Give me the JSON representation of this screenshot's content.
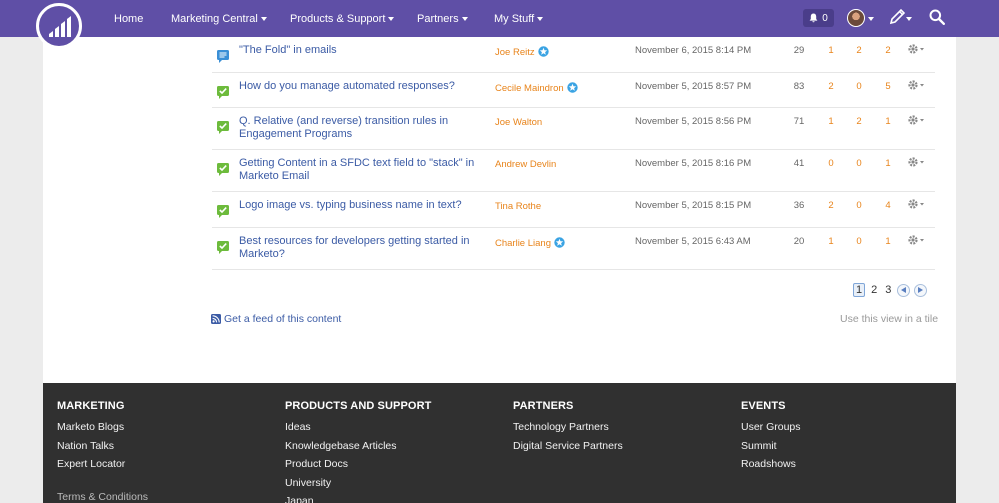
{
  "nav": {
    "items": [
      "Home",
      "Marketing Central",
      "Products & Support",
      "Partners",
      "My Stuff"
    ],
    "notifications": "0",
    "icons": [
      "marketo-logo-icon",
      "bell-icon",
      "avatar",
      "pencil-icon",
      "search-icon"
    ]
  },
  "threads": [
    {
      "icon": "discussion",
      "title": "\"The Fold\" in emails",
      "author": "Joe Reitz",
      "badge": true,
      "date": "November 6, 2015 8:14 PM",
      "views": "29",
      "c1": "1",
      "c2": "2",
      "c3": "2"
    },
    {
      "icon": "answered",
      "title": "How do you manage automated responses?",
      "author": "Cecile Maindron",
      "badge": true,
      "date": "November 5, 2015 8:57 PM",
      "views": "83",
      "c1": "2",
      "c2": "0",
      "c3": "5"
    },
    {
      "icon": "answered",
      "title": "Q. Relative (and reverse) transition rules in Engagement Programs",
      "author": "Joe Walton",
      "badge": false,
      "date": "November 5, 2015 8:56 PM",
      "views": "71",
      "c1": "1",
      "c2": "2",
      "c3": "1"
    },
    {
      "icon": "answered",
      "title": "Getting Content in a SFDC text field to \"stack\" in Marketo Email",
      "author": "Andrew Devlin",
      "badge": false,
      "date": "November 5, 2015 8:16 PM",
      "views": "41",
      "c1": "0",
      "c2": "0",
      "c3": "1"
    },
    {
      "icon": "answered",
      "title": "Logo image vs. typing business name in text?",
      "author": "Tina Rothe",
      "badge": false,
      "date": "November 5, 2015 8:15 PM",
      "views": "36",
      "c1": "2",
      "c2": "0",
      "c3": "4"
    },
    {
      "icon": "answered",
      "title": "Best resources for developers getting started in Marketo?",
      "author": "Charlie Liang",
      "badge": true,
      "date": "November 5, 2015 6:43 AM",
      "views": "20",
      "c1": "1",
      "c2": "0",
      "c3": "1"
    }
  ],
  "pagination": {
    "pages": [
      "1",
      "2",
      "3"
    ],
    "current": "1"
  },
  "feed_link": "Get a feed of this content",
  "tile_link": "Use this view in a tile",
  "footer": {
    "columns": [
      {
        "heading": "MARKETING",
        "links": [
          "Marketo Blogs",
          "Nation Talks",
          "Expert Locator"
        ]
      },
      {
        "heading": "PRODUCTS AND SUPPORT",
        "links": [
          "Ideas",
          "Knowledgebase Articles",
          "Product Docs",
          "University",
          "Japan"
        ]
      },
      {
        "heading": "PARTNERS",
        "links": [
          "Technology Partners",
          "Digital Service Partners"
        ]
      },
      {
        "heading": "EVENTS",
        "links": [
          "User Groups",
          "Summit",
          "Roadshows"
        ]
      }
    ],
    "terms": "Terms & Conditions"
  },
  "colors": {
    "brand": "#5f4fa6",
    "link": "#3b5ba5",
    "author": "#e8841b",
    "answered": "#6dbb3c",
    "footer": "#303030"
  }
}
